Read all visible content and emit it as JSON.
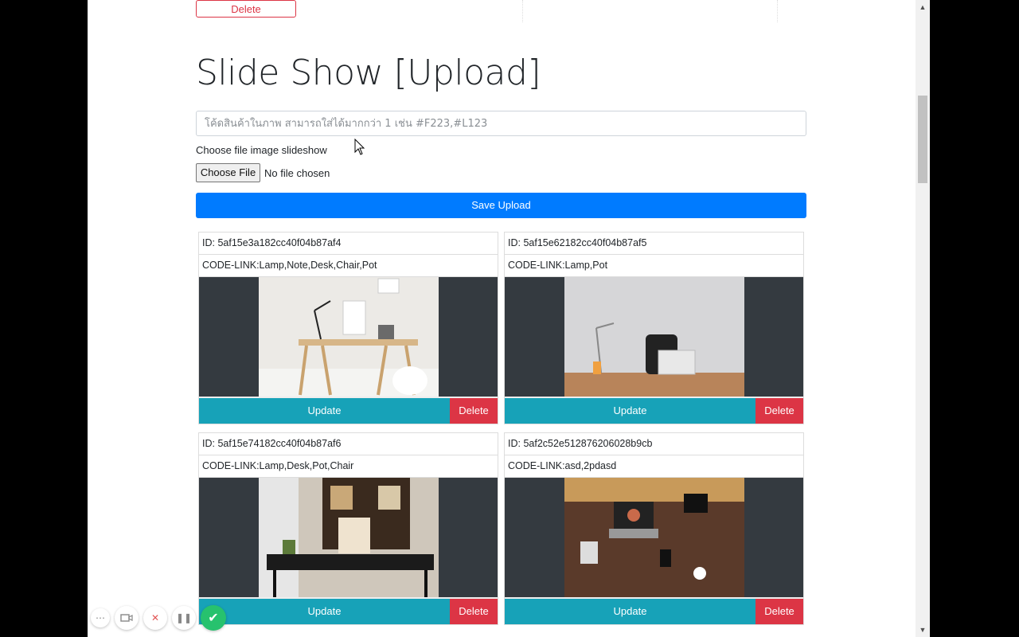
{
  "top_delete_label": "Delete",
  "title": "Slide Show [Upload]",
  "code_input": {
    "placeholder": "โค้ดสินค้าในภาพ สามารถใส่ได้มากกว่า 1 เช่น #F223,#L123",
    "value": ""
  },
  "file_label": "Choose file image slideshow",
  "file_button": "Choose File",
  "file_status": "No file chosen",
  "save_button": "Save Upload",
  "cards": [
    {
      "id": "ID: 5af15e3a182cc40f04b87af4",
      "codes": "CODE-LINK:Lamp,Note,Desk,Chair,Pot",
      "update": "Update",
      "delete": "Delete"
    },
    {
      "id": "ID: 5af15e62182cc40f04b87af5",
      "codes": "CODE-LINK:Lamp,Pot",
      "update": "Update",
      "delete": "Delete"
    },
    {
      "id": "ID: 5af15e74182cc40f04b87af6",
      "codes": "CODE-LINK:Lamp,Desk,Pot,Chair",
      "update": "Update",
      "delete": "Delete"
    },
    {
      "id": "ID: 5af2c52e512876206028b9cb",
      "codes": "CODE-LINK:asd,2pdasd",
      "update": "Update",
      "delete": "Delete"
    }
  ],
  "colors": {
    "primary": "#007bff",
    "info": "#17a2b8",
    "danger": "#dc3545",
    "dark": "#343a40"
  }
}
